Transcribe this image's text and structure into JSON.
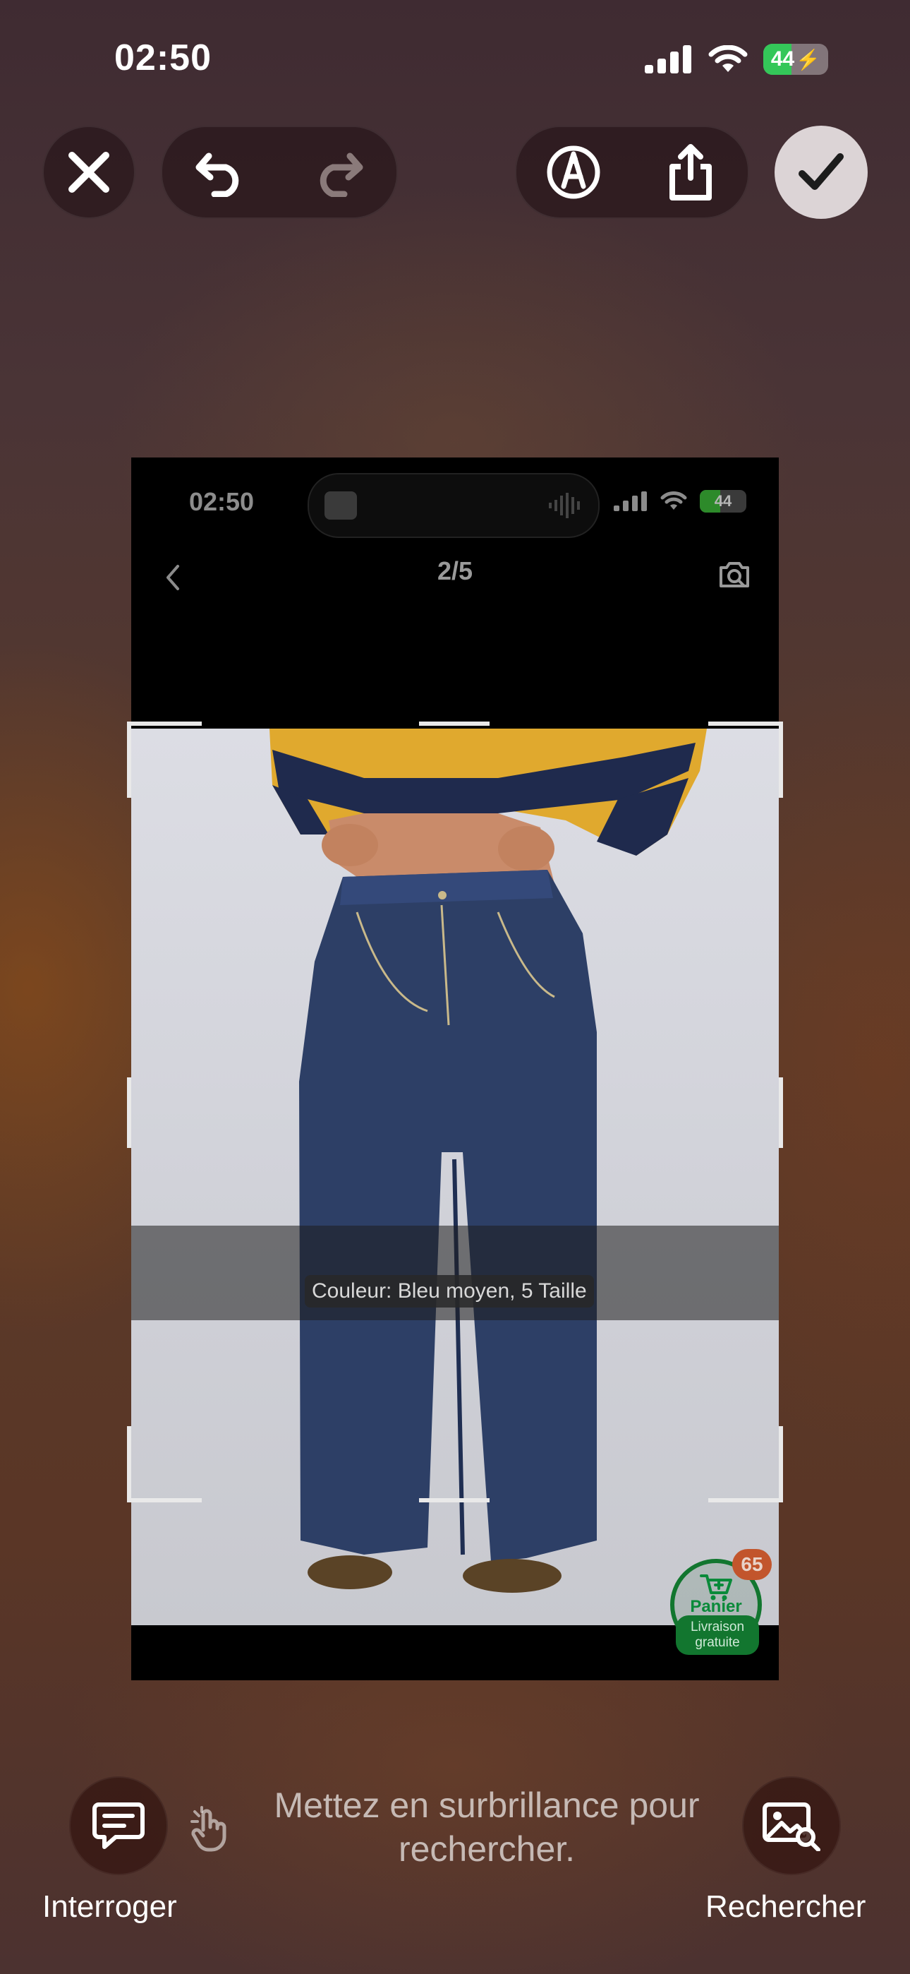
{
  "status_bar": {
    "time": "02:50",
    "battery": "44",
    "battery_level": 0.44
  },
  "toolbar": {
    "close_icon": "xmark-icon",
    "undo_icon": "undo-arrow-icon",
    "redo_icon": "redo-arrow-icon",
    "markup_icon": "markup-pen-icon",
    "share_icon": "share-icon",
    "done_icon": "checkmark-icon"
  },
  "screenshot": {
    "status_time": "02:50",
    "battery": "44",
    "page_counter": "2/5",
    "caption": "Couleur: Bleu moyen, 5 Taille",
    "cart_badge": "65",
    "cart_label": "Panier",
    "delivery_label": "Livraison gratuite"
  },
  "bottom": {
    "ask_label": "Interroger",
    "hint": "Mettez en surbrillance pour rechercher.",
    "search_label": "Rechercher"
  },
  "colors": {
    "accent_green": "#34c759",
    "cart_green": "#12762f",
    "badge_orange": "#c2552c"
  }
}
